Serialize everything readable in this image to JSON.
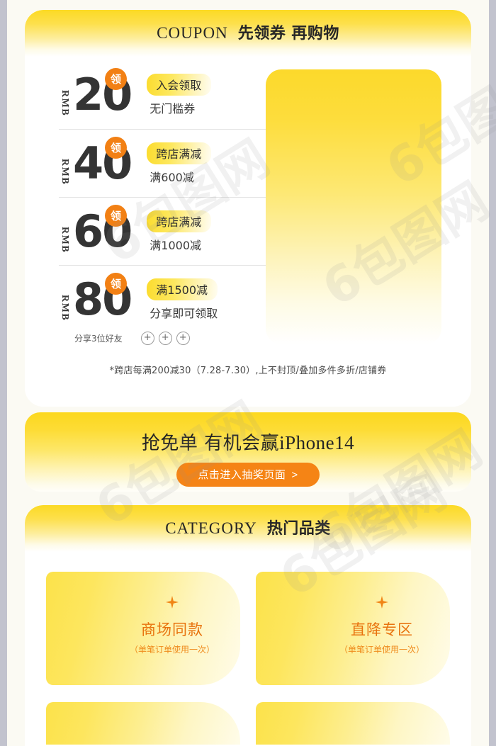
{
  "page": {
    "background_color": "#fbfaf3",
    "rail_color": "#c2c3ce",
    "accent_yellow": "#fcd92b",
    "accent_orange": "#f28014",
    "text_dark": "#2e2e2e"
  },
  "coupon_section": {
    "header": {
      "en_title": "COUPON",
      "cn_title": "先领券 再购物"
    },
    "coupons": [
      {
        "currency": "RMB",
        "amount": "20",
        "badge": "领",
        "pill": "入会领取",
        "sub": "无门槛券"
      },
      {
        "currency": "RMB",
        "amount": "40",
        "badge": "领",
        "pill": "跨店满减",
        "sub": "满600减"
      },
      {
        "currency": "RMB",
        "amount": "60",
        "badge": "领",
        "pill": "跨店满减",
        "sub": "满1000减"
      },
      {
        "currency": "RMB",
        "amount": "80",
        "badge": "领",
        "pill": "满1500减",
        "sub": "分享即可领取"
      }
    ],
    "share": {
      "label": "分享3位好友",
      "slots": [
        "+",
        "+",
        "+"
      ]
    },
    "footnote": "*跨店每满200减30（7.28-7.30）,上不封顶/叠加多件多折/店铺券"
  },
  "lottery_banner": {
    "headline_cn": "抢免单 有机会赢",
    "headline_en": "iPhone14",
    "cta_label": "点击进入抽奖页面",
    "cta_chevron": ">"
  },
  "category_section": {
    "header": {
      "en_title": "CATEGORY",
      "cn_title": "热门品类"
    },
    "cards": [
      {
        "title": "商场同款",
        "sub": "（单笔订单使用一次）",
        "icon": "sparkle-icon"
      },
      {
        "title": "直降专区",
        "sub": "（单笔订单使用一次）",
        "icon": "sparkle-icon"
      },
      {
        "title": "",
        "sub": "",
        "icon": "sparkle-icon"
      },
      {
        "title": "",
        "sub": "",
        "icon": "sparkle-icon"
      }
    ]
  },
  "watermarks": [
    "6包图网",
    "6包图网",
    "6包图网",
    "6包图网",
    "6包图网",
    "6包图网"
  ]
}
